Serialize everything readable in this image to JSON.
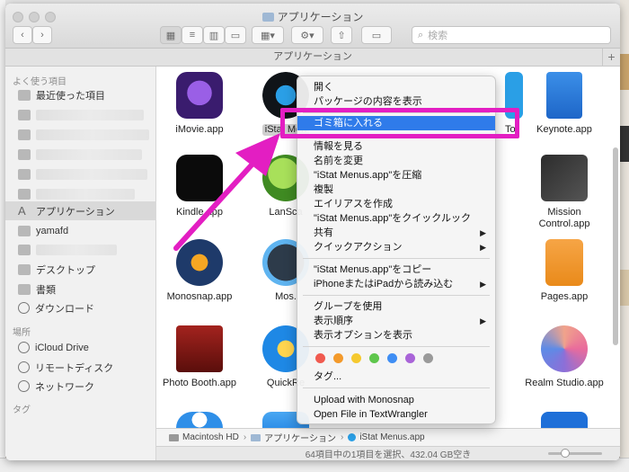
{
  "window": {
    "title": "アプリケーション",
    "path_tab": "アプリケーション"
  },
  "toolbar": {
    "back": "‹",
    "forward": "›",
    "search_placeholder": "検索"
  },
  "sidebar": {
    "favorites_header": "よく使う項目",
    "recent": "最近使った項目",
    "applications": "アプリケーション",
    "user": "yamafd",
    "desktop": "デスクトップ",
    "documents": "書類",
    "downloads": "ダウンロード",
    "places_header": "場所",
    "icloud": "iCloud Drive",
    "remote_disk": "リモートディスク",
    "network": "ネットワーク",
    "tags_header": "タグ"
  },
  "apps": {
    "imovie": "iMovie.app",
    "istat": "iStat Men",
    "rowone_partial": "To",
    "keynote": "Keynote.app",
    "kindle": "Kindle.app",
    "lanscan": "LanSca",
    "mission_control_1": "Mission",
    "mission_control_2": "Control.app",
    "monosnap": "Monosnap.app",
    "mos": "Mos.",
    "pages": "Pages.app",
    "photo_booth": "Photo Booth.app",
    "quickres": "QuickRe",
    "realm": "Realm Studio.app"
  },
  "context_menu": {
    "open": "開く",
    "show_contents": "パッケージの内容を表示",
    "trash": "ゴミ箱に入れる",
    "get_info": "情報を見る",
    "rename": "名前を変更",
    "compress": "\"iStat Menus.app\"を圧縮",
    "duplicate": "複製",
    "make_alias": "エイリアスを作成",
    "quick_look": "\"iStat Menus.app\"をクイックルック",
    "share": "共有",
    "quick_actions": "クイックアクション",
    "copy": "\"iStat Menus.app\"をコピー",
    "import_iphone": "iPhoneまたはiPadから読み込む",
    "use_groups": "グループを使用",
    "sort_by": "表示順序",
    "view_options": "表示オプションを表示",
    "tags": "タグ...",
    "monosnap_upload": "Upload with Monosnap",
    "textwrangler": "Open File in TextWrangler",
    "tag_colors": [
      "#f05a4f",
      "#f39a2b",
      "#f5c92f",
      "#5ec64c",
      "#3f8ef4",
      "#a964d8",
      "#9a9a9a"
    ]
  },
  "pathbar": {
    "hd": "Macintosh HD",
    "apps": "アプリケーション",
    "item": "iStat Menus.app"
  },
  "status": {
    "text": "64項目中の1項目を選択、432.04 GB空き"
  },
  "accent": {
    "highlight": "#2f7bea",
    "annotation": "#e31ec2"
  }
}
